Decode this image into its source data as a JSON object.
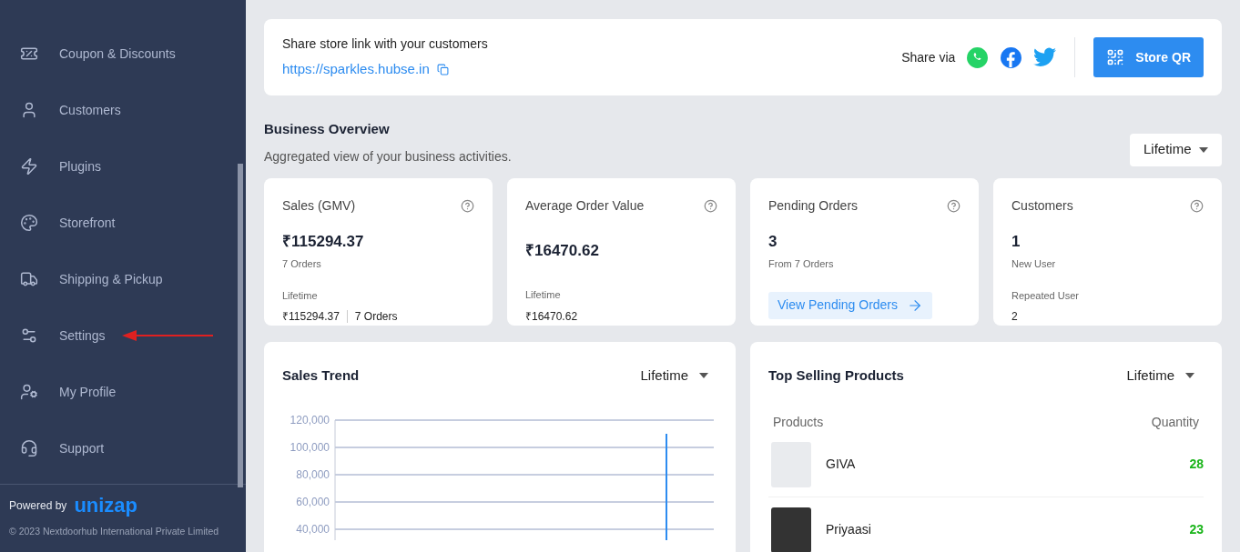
{
  "sidebar": {
    "items": [
      {
        "kind": "coupon",
        "label": "Coupon & Discounts"
      },
      {
        "kind": "user",
        "label": "Customers"
      },
      {
        "kind": "bolt",
        "label": "Plugins"
      },
      {
        "kind": "palette",
        "label": "Storefront"
      },
      {
        "kind": "truck",
        "label": "Shipping & Pickup"
      },
      {
        "kind": "settings",
        "label": "Settings",
        "annotated": true
      },
      {
        "kind": "profile",
        "label": "My Profile"
      },
      {
        "kind": "headset",
        "label": "Support"
      }
    ],
    "powered_by": "Powered by",
    "brand": "unizap",
    "copyright": "© 2023 Nextdoorhub International Private Limited"
  },
  "share": {
    "title": "Share store link with your customers",
    "link": "https://sparkles.hubse.in",
    "share_via": "Share via",
    "qr_button": "Store QR"
  },
  "overview": {
    "title": "Business Overview",
    "subtitle": "Aggregated view of your business activities.",
    "period": "Lifetime"
  },
  "cards": [
    {
      "title": "Sales (GMV)",
      "value": "₹115294.37",
      "sub": "7 Orders",
      "foot_label": "Lifetime",
      "foot_values": [
        "₹115294.37",
        "7 Orders"
      ]
    },
    {
      "title": "Average Order Value",
      "value": "₹16470.62",
      "foot_label": "Lifetime",
      "foot_values": [
        "₹16470.62"
      ]
    },
    {
      "title": "Pending Orders",
      "value": "3",
      "sub": "From 7 Orders",
      "action": "View Pending Orders"
    },
    {
      "title": "Customers",
      "value": "1",
      "sub": "New User",
      "foot_label": "Repeated User",
      "foot_values": [
        "2"
      ]
    }
  ],
  "sales_trend": {
    "title": "Sales Trend",
    "period": "Lifetime",
    "chart_data": {
      "type": "bar",
      "grid": true,
      "ylim": [
        0,
        120000
      ],
      "yticks": [
        {
          "value": 40000,
          "label": "40,000"
        },
        {
          "value": 60000,
          "label": "60,000"
        },
        {
          "value": 80000,
          "label": "80,000"
        },
        {
          "value": 100000,
          "label": "100,000"
        },
        {
          "value": 120000,
          "label": "120,000"
        }
      ],
      "series": [
        {
          "color": "#2d8cf0",
          "values": [
            0,
            0,
            0,
            0,
            0,
            0,
            0,
            0,
            0,
            0,
            110000,
            0
          ]
        }
      ]
    }
  },
  "top_products": {
    "title": "Top Selling Products",
    "period": "Lifetime",
    "columns": [
      "Products",
      "Quantity"
    ],
    "rows": [
      {
        "name": "GIVA",
        "quantity": "28",
        "kind": "light"
      },
      {
        "name": "Priyaasi",
        "quantity": "23",
        "kind": "dark"
      }
    ]
  }
}
